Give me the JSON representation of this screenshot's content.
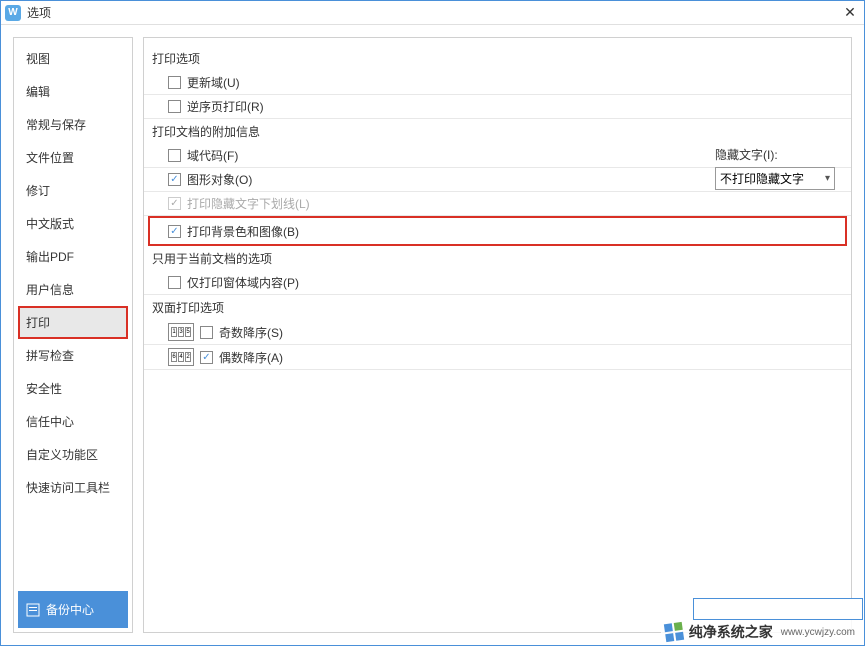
{
  "titlebar": {
    "title": "选项"
  },
  "sidebar": {
    "items": [
      {
        "label": "视图"
      },
      {
        "label": "编辑"
      },
      {
        "label": "常规与保存"
      },
      {
        "label": "文件位置"
      },
      {
        "label": "修订"
      },
      {
        "label": "中文版式"
      },
      {
        "label": "输出PDF"
      },
      {
        "label": "用户信息"
      },
      {
        "label": "打印",
        "selected": true
      },
      {
        "label": "拼写检查"
      },
      {
        "label": "安全性"
      },
      {
        "label": "信任中心"
      },
      {
        "label": "自定义功能区"
      },
      {
        "label": "快速访问工具栏"
      }
    ],
    "backup_label": "备份中心"
  },
  "content": {
    "section1": {
      "title": "打印选项",
      "opt1": {
        "label": "更新域(U)",
        "checked": false
      },
      "opt2": {
        "label": "逆序页打印(R)",
        "checked": false
      }
    },
    "section2": {
      "title": "打印文档的附加信息",
      "opt1": {
        "label": "域代码(F)",
        "checked": false
      },
      "opt2": {
        "label": "图形对象(O)",
        "checked": true
      },
      "opt3": {
        "label": "打印隐藏文字下划线(L)",
        "checked": true,
        "disabled": true
      },
      "opt4": {
        "label": "打印背景色和图像(B)",
        "checked": true
      },
      "hidden_text_label": "隐藏文字(I):",
      "hidden_text_value": "不打印隐藏文字"
    },
    "section3": {
      "title": "只用于当前文档的选项",
      "opt1": {
        "label": "仅打印窗体域内容(P)",
        "checked": false
      }
    },
    "section4": {
      "title": "双面打印选项",
      "opt1": {
        "label": "奇数降序(S)",
        "checked": false,
        "pages": "135"
      },
      "opt2": {
        "label": "偶数降序(A)",
        "checked": true,
        "pages": "642"
      }
    }
  },
  "watermark": {
    "text": "纯净系统之家",
    "url": "www.ycwjzy.com"
  }
}
